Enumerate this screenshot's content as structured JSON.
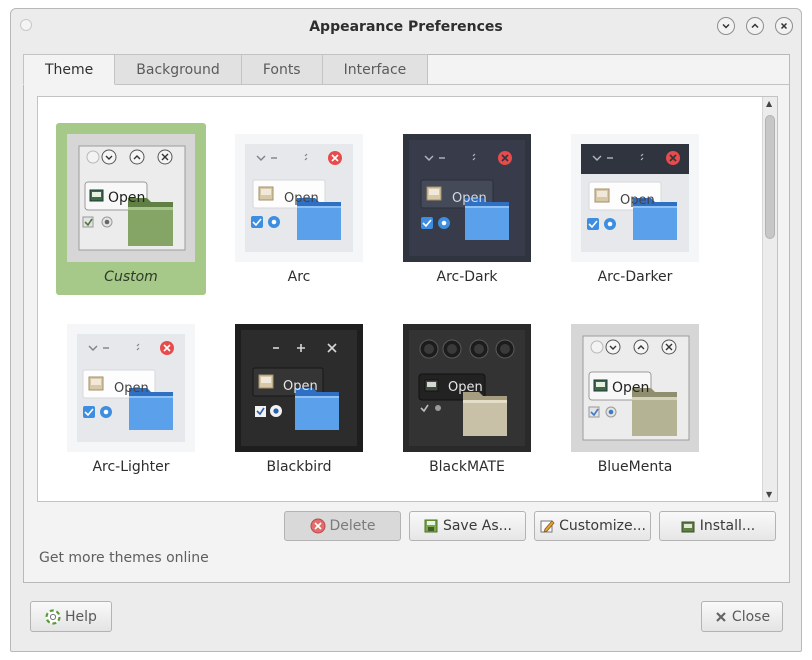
{
  "window": {
    "title": "Appearance Preferences"
  },
  "tabs": [
    {
      "label": "Theme",
      "active": true
    },
    {
      "label": "Background",
      "active": false
    },
    {
      "label": "Fonts",
      "active": false
    },
    {
      "label": "Interface",
      "active": false
    }
  ],
  "themes": [
    {
      "name": "Custom",
      "selected": true,
      "open_label": "Open"
    },
    {
      "name": "Arc",
      "selected": false,
      "open_label": "Open"
    },
    {
      "name": "Arc-Dark",
      "selected": false,
      "open_label": "Open"
    },
    {
      "name": "Arc-Darker",
      "selected": false,
      "open_label": "Open"
    },
    {
      "name": "Arc-Lighter",
      "selected": false,
      "open_label": "Open"
    },
    {
      "name": "Blackbird",
      "selected": false,
      "open_label": "Open"
    },
    {
      "name": "BlackMATE",
      "selected": false,
      "open_label": "Open"
    },
    {
      "name": "BlueMenta",
      "selected": false,
      "open_label": "Open"
    }
  ],
  "actions": {
    "delete_label": "Delete",
    "save_as_label": "Save As...",
    "customize_label": "Customize...",
    "install_label": "Install..."
  },
  "get_more_link": "Get more themes online",
  "footer": {
    "help_label": "Help",
    "close_label": "Close"
  },
  "colors": {
    "selection": "#a6c98a",
    "arc_blue": "#3d8ee0",
    "arc_close": "#e84b4b",
    "mint_folder": "#8ea56b"
  }
}
